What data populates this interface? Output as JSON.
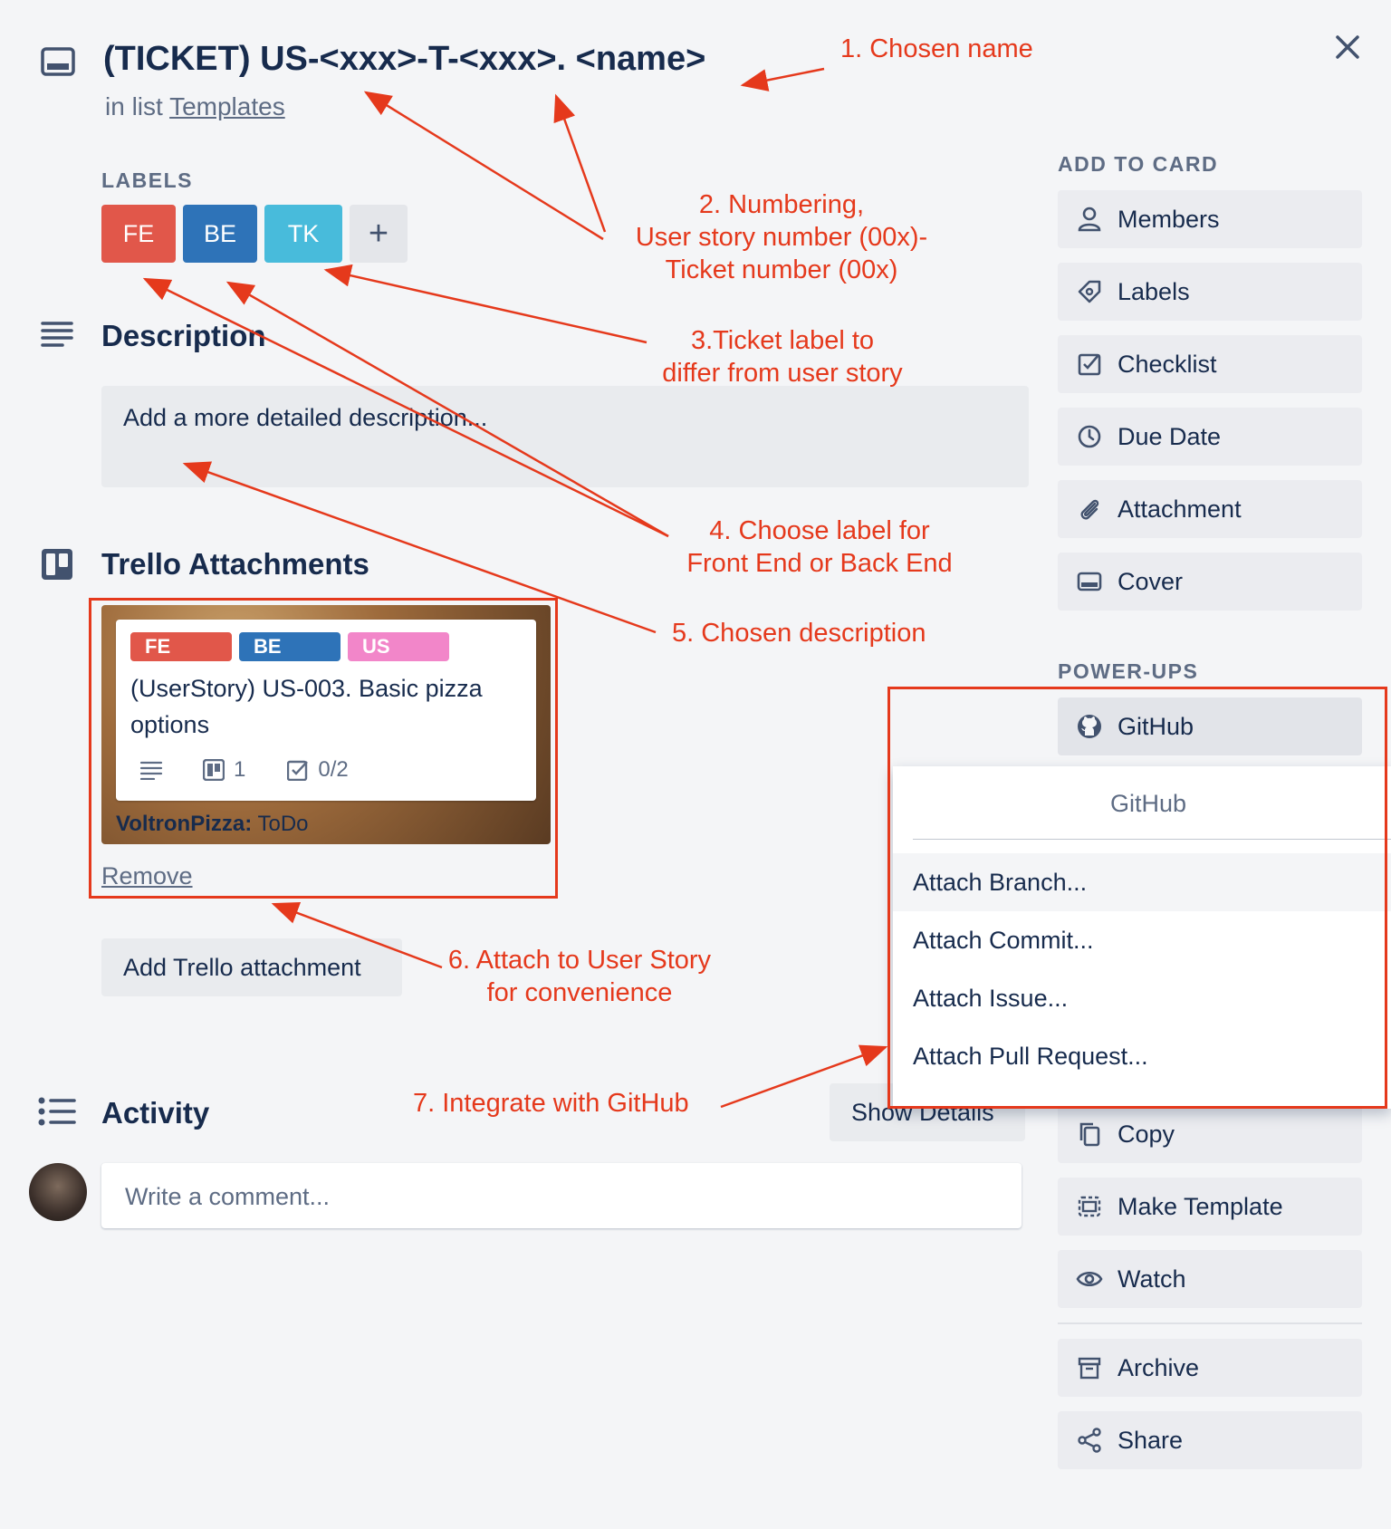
{
  "header": {
    "title": "(TICKET) US-<xxx>-T-<xxx>. <name>",
    "in_list_prefix": "in list",
    "list_name": "Templates"
  },
  "labels": {
    "heading": "LABELS",
    "items": [
      {
        "text": "FE",
        "color": "#eb5a46"
      },
      {
        "text": "BE",
        "color": "#0079bf"
      },
      {
        "text": "TK",
        "color": "#00c2e0"
      }
    ],
    "add_symbol": "+"
  },
  "description": {
    "heading": "Description",
    "placeholder": "Add a more detailed description..."
  },
  "trello_attachments": {
    "heading": "Trello Attachments",
    "card": {
      "labels": [
        {
          "text": "FE",
          "color": "#eb5a46"
        },
        {
          "text": "BE",
          "color": "#0079bf"
        },
        {
          "text": "US",
          "color": "#ff78cb"
        }
      ],
      "title": "(UserStory) US-003. Basic pizza options",
      "attachments_count": "1",
      "checklist": "0/2",
      "board": "VoltronPizza:",
      "list": "ToDo"
    },
    "remove_label": "Remove",
    "add_button": "Add Trello attachment"
  },
  "activity": {
    "heading": "Activity",
    "show_details": "Show Details",
    "comment_placeholder": "Write a comment..."
  },
  "sidebar": {
    "add_to_card_heading": "ADD TO CARD",
    "add_to_card": [
      {
        "label": "Members",
        "icon": "person-icon"
      },
      {
        "label": "Labels",
        "icon": "tag-icon"
      },
      {
        "label": "Checklist",
        "icon": "checkbox-icon"
      },
      {
        "label": "Due Date",
        "icon": "clock-icon"
      },
      {
        "label": "Attachment",
        "icon": "paperclip-icon"
      },
      {
        "label": "Cover",
        "icon": "card-icon"
      }
    ],
    "powerups_heading": "POWER-UPS",
    "github_label": "GitHub",
    "actions": [
      {
        "label": "Copy",
        "icon": "copy-icon"
      },
      {
        "label": "Make Template",
        "icon": "template-icon"
      },
      {
        "label": "Watch",
        "icon": "eye-icon"
      },
      {
        "label": "Archive",
        "icon": "archive-icon"
      },
      {
        "label": "Share",
        "icon": "share-icon"
      }
    ]
  },
  "github_popover": {
    "title": "GitHub",
    "items": [
      "Attach Branch...",
      "Attach Commit...",
      "Attach Issue...",
      "Attach Pull Request..."
    ]
  },
  "annotations": {
    "a1": "1. Chosen name",
    "a2_l1": "2. Numbering,",
    "a2_l2": "User story number (00x)-",
    "a2_l3": "Ticket number (00x)",
    "a3_l1": "3.Ticket label to",
    "a3_l2": "differ from user story",
    "a4_l1": "4. Choose label for",
    "a4_l2": "Front End or Back End",
    "a5": "5. Chosen description",
    "a6_l1": "6. Attach to User Story",
    "a6_l2": "for convenience",
    "a7": "7. Integrate with GitHub"
  },
  "colors": {
    "annotation": "#e5391c",
    "background": "#f4f5f7"
  }
}
